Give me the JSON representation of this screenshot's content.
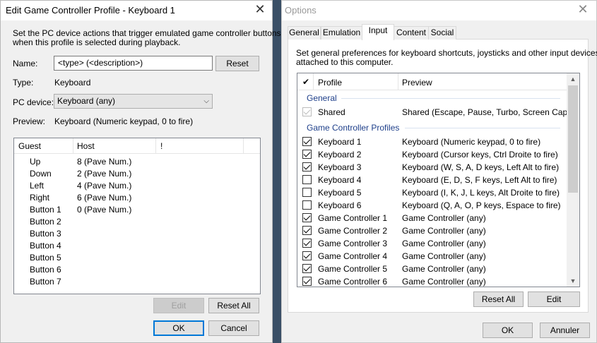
{
  "left_dialog": {
    "title": "Edit Game Controller Profile - Keyboard 1",
    "description_line1": "Set the PC device actions that trigger emulated game controller buttons",
    "description_line2": "when this profile is selected during playback.",
    "name_label": "Name:",
    "name_value": "<type> (<description>)",
    "reset_label": "Reset",
    "type_label": "Type:",
    "type_value": "Keyboard",
    "pc_device_label": "PC device:",
    "pc_device_value": "Keyboard (any)",
    "preview_label": "Preview:",
    "preview_value": "Keyboard (Numeric keypad, 0 to fire)",
    "columns": {
      "guest": "Guest",
      "host": "Host",
      "flag": "!"
    },
    "mappings": [
      {
        "guest": "Up",
        "host": "8 (Pave Num.)"
      },
      {
        "guest": "Down",
        "host": "2 (Pave Num.)"
      },
      {
        "guest": "Left",
        "host": "4 (Pave Num.)"
      },
      {
        "guest": "Right",
        "host": "6 (Pave Num.)"
      },
      {
        "guest": "Button 1",
        "host": "0 (Pave Num.)"
      },
      {
        "guest": "Button 2",
        "host": ""
      },
      {
        "guest": "Button 3",
        "host": ""
      },
      {
        "guest": "Button 4",
        "host": ""
      },
      {
        "guest": "Button 5",
        "host": ""
      },
      {
        "guest": "Button 6",
        "host": ""
      },
      {
        "guest": "Button 7",
        "host": ""
      }
    ],
    "edit_label": "Edit",
    "reset_all_label": "Reset All",
    "ok_label": "OK",
    "cancel_label": "Cancel"
  },
  "options_dialog": {
    "title": "Options",
    "tabs": [
      "General",
      "Emulation",
      "Input",
      "Content",
      "Social"
    ],
    "active_tab": "Input",
    "description_line1": "Set general preferences for keyboard shortcuts, joysticks and other input devices",
    "description_line2": "attached to this computer.",
    "columns": {
      "check": "✔",
      "profile": "Profile",
      "preview": "Preview"
    },
    "group_general": "General",
    "shared": {
      "name": "Shared",
      "preview": "Shared (Escape, Pause, Turbo, Screen Cap...",
      "checked": true,
      "disabled": true
    },
    "group_profiles": "Game Controller Profiles",
    "profiles": [
      {
        "name": "Keyboard 1",
        "preview": "Keyboard (Numeric keypad, 0 to fire)",
        "checked": true
      },
      {
        "name": "Keyboard 2",
        "preview": "Keyboard (Cursor keys, Ctrl Droite to fire)",
        "checked": true
      },
      {
        "name": "Keyboard 3",
        "preview": "Keyboard (W, S, A, D keys, Left Alt to fire)",
        "checked": true
      },
      {
        "name": "Keyboard 4",
        "preview": "Keyboard (E, D, S, F keys, Left Alt to fire)",
        "checked": false
      },
      {
        "name": "Keyboard 5",
        "preview": "Keyboard (I, K, J, L keys, Alt Droite to fire)",
        "checked": false
      },
      {
        "name": "Keyboard 6",
        "preview": "Keyboard (Q, A, O, P keys, Espace to fire)",
        "checked": false
      },
      {
        "name": "Game Controller 1",
        "preview": "Game Controller (any)",
        "checked": true
      },
      {
        "name": "Game Controller 2",
        "preview": "Game Controller (any)",
        "checked": true
      },
      {
        "name": "Game Controller 3",
        "preview": "Game Controller (any)",
        "checked": true
      },
      {
        "name": "Game Controller 4",
        "preview": "Game Controller (any)",
        "checked": true
      },
      {
        "name": "Game Controller 5",
        "preview": "Game Controller (any)",
        "checked": true
      },
      {
        "name": "Game Controller 6",
        "preview": "Game Controller (any)",
        "checked": true
      }
    ],
    "reset_all_label": "Reset All",
    "edit_label": "Edit",
    "ok_label": "OK",
    "cancel_label": "Annuler"
  }
}
